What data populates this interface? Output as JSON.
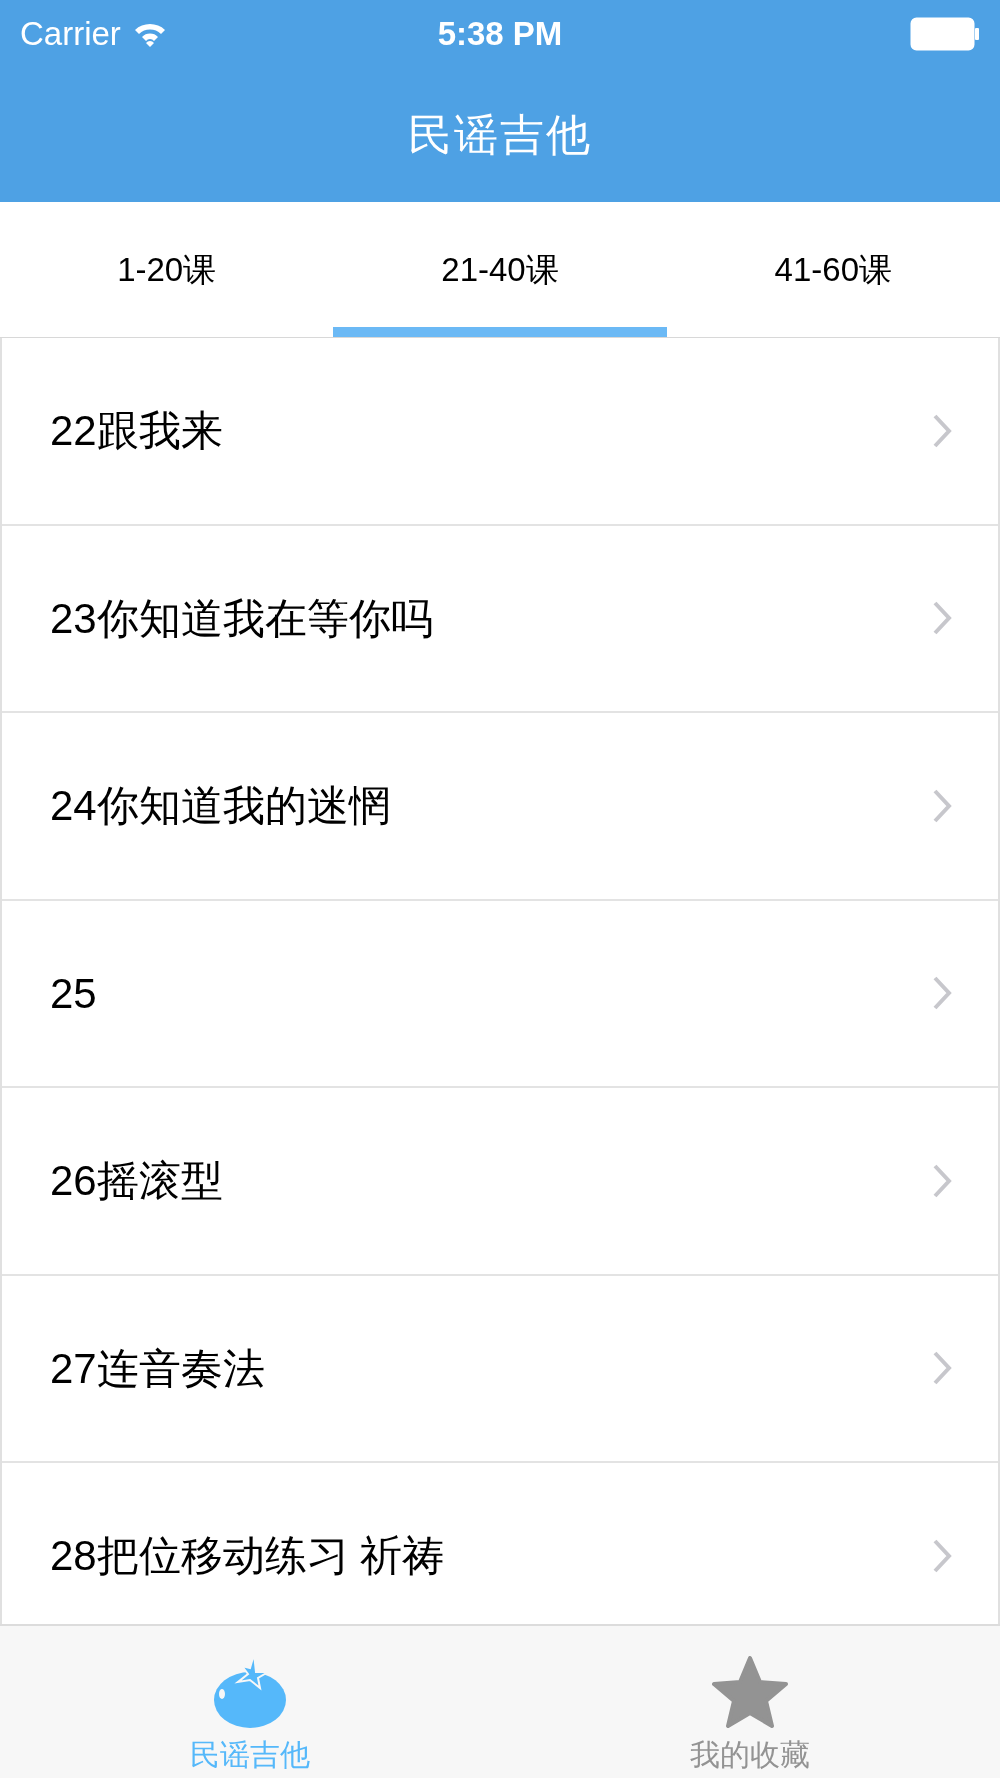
{
  "status_bar": {
    "carrier": "Carrier",
    "time": "5:38 PM"
  },
  "title": "民谣吉他",
  "tabs": [
    {
      "label": "1-20课",
      "selected": false
    },
    {
      "label": "21-40课",
      "selected": true
    },
    {
      "label": "41-60课",
      "selected": false
    }
  ],
  "rows": [
    {
      "label": "22跟我来"
    },
    {
      "label": "23你知道我在等你吗"
    },
    {
      "label": "24你知道我的迷惘"
    },
    {
      "label": "25"
    },
    {
      "label": "26摇滚型"
    },
    {
      "label": "27连音奏法"
    },
    {
      "label": "28把位移动练习 祈祷"
    }
  ],
  "tab_bar": [
    {
      "label": "民谣吉他",
      "kind": "tomato",
      "selected": true
    },
    {
      "label": "我的收藏",
      "kind": "star",
      "selected": false
    }
  ]
}
